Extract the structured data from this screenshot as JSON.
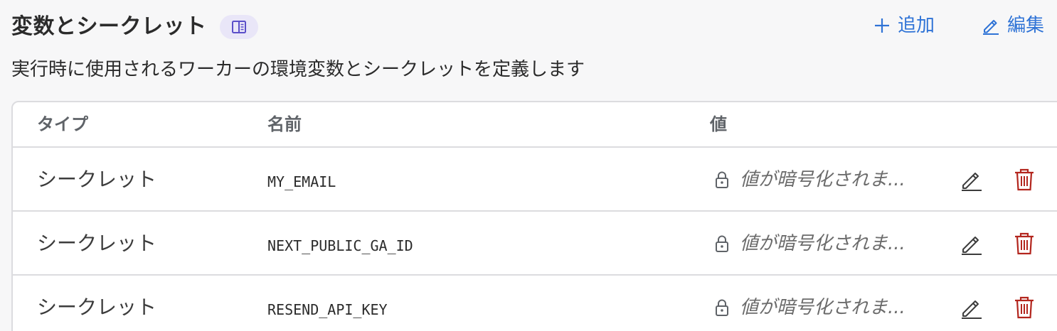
{
  "header": {
    "title": "変数とシークレット",
    "add_label": "追加",
    "edit_label": "編集"
  },
  "subtitle": "実行時に使用されるワーカーの環境変数とシークレットを定義します",
  "table": {
    "columns": [
      "タイプ",
      "名前",
      "値"
    ],
    "rows": [
      {
        "type": "シークレット",
        "name": "MY_EMAIL",
        "value": "値が暗号化されま..."
      },
      {
        "type": "シークレット",
        "name": "NEXT_PUBLIC_GA_ID",
        "value": "値が暗号化されま..."
      },
      {
        "type": "シークレット",
        "name": "RESEND_API_KEY",
        "value": "値が暗号化されま..."
      }
    ]
  },
  "colors": {
    "accent": "#2f73d6",
    "danger": "#b3261e",
    "badge_bg": "#e9e6f8",
    "badge_icon": "#5b4fc9"
  },
  "icons": {
    "docs": "book-icon",
    "add": "plus-icon",
    "edit": "pencil-icon",
    "lock": "lock-icon",
    "delete": "trash-icon"
  }
}
